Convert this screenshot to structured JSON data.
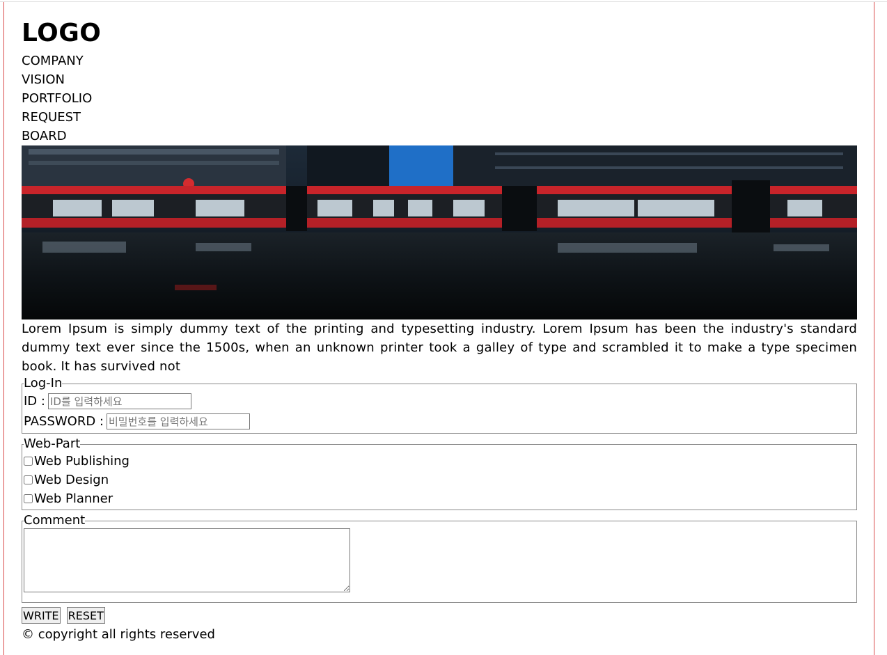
{
  "header": {
    "logo": "LOGO"
  },
  "nav": {
    "items": [
      "COMPANY",
      "VISION",
      "PORTFOLIO",
      "REQUEST",
      "BOARD"
    ]
  },
  "hero": {
    "subject": "night city street with red and white streetcar"
  },
  "main": {
    "paragraph": "Lorem Ipsum is simply dummy text of the printing and typesetting industry. Lorem Ipsum has been the industry's standard dummy text ever since the 1500s, when an unknown printer took a galley of type and scrambled it to make a type specimen book. It has survived not"
  },
  "login": {
    "legend": "Log-In",
    "id_label": "ID :",
    "id_placeholder": "ID를 입력하세요",
    "password_label": "PASSWORD :",
    "password_placeholder": "비밀번호를 입력하세요"
  },
  "webpart": {
    "legend": "Web-Part",
    "options": [
      "Web Publishing",
      "Web Design",
      "Web Planner"
    ]
  },
  "comment": {
    "legend": "Comment"
  },
  "actions": {
    "write_label": "WRITE",
    "reset_label": "RESET"
  },
  "footer": {
    "text": "© copyright all rights reserved"
  },
  "colors": {
    "frame_border": "#d94a4a"
  }
}
